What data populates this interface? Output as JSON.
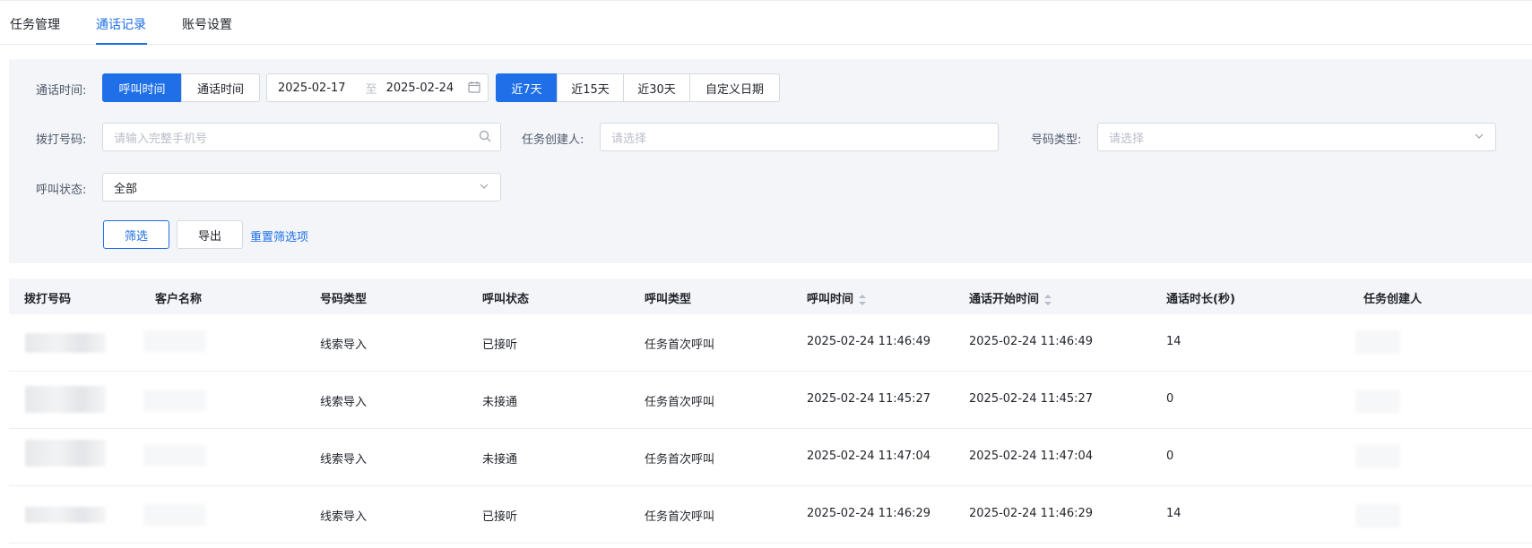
{
  "tabs": [
    {
      "label": "任务管理"
    },
    {
      "label": "通话记录"
    },
    {
      "label": "账号设置"
    }
  ],
  "filters": {
    "call_time_label": "通话时间:",
    "time_type_options": [
      "呼叫时间",
      "通话时间"
    ],
    "date_start": "2025-02-17",
    "date_sep": "至",
    "date_end": "2025-02-24",
    "range_options": [
      "近7天",
      "近15天",
      "近30天",
      "自定义日期"
    ],
    "dial_number_label": "拨打号码:",
    "dial_number_placeholder": "请输入完整手机号",
    "creator_label": "任务创建人:",
    "creator_placeholder": "请选择",
    "number_type_label": "号码类型:",
    "number_type_placeholder": "请选择",
    "call_status_label": "呼叫状态:",
    "call_status_value": "全部",
    "filter_button": "筛选",
    "export_button": "导出",
    "reset_link": "重置筛选项"
  },
  "table": {
    "columns": [
      "拨打号码",
      "客户名称",
      "号码类型",
      "呼叫状态",
      "呼叫类型",
      "呼叫时间",
      "通话开始时间",
      "通话时长(秒)",
      "任务创建人"
    ],
    "rows": [
      {
        "number_type": "线索导入",
        "call_status": "已接听",
        "call_type": "任务首次呼叫",
        "call_time": "2025-02-24 11:46:49",
        "start_time": "2025-02-24 11:46:49",
        "duration": "14"
      },
      {
        "number_type": "线索导入",
        "call_status": "未接通",
        "call_type": "任务首次呼叫",
        "call_time": "2025-02-24 11:45:27",
        "start_time": "2025-02-24 11:45:27",
        "duration": "0"
      },
      {
        "number_type": "线索导入",
        "call_status": "未接通",
        "call_type": "任务首次呼叫",
        "call_time": "2025-02-24 11:47:04",
        "start_time": "2025-02-24 11:47:04",
        "duration": "0"
      },
      {
        "number_type": "线索导入",
        "call_status": "已接听",
        "call_type": "任务首次呼叫",
        "call_time": "2025-02-24 11:46:29",
        "start_time": "2025-02-24 11:46:29",
        "duration": "14"
      }
    ]
  },
  "colors": {
    "accent": "#1e6fe8",
    "panel_bg": "#f3f5f9"
  }
}
